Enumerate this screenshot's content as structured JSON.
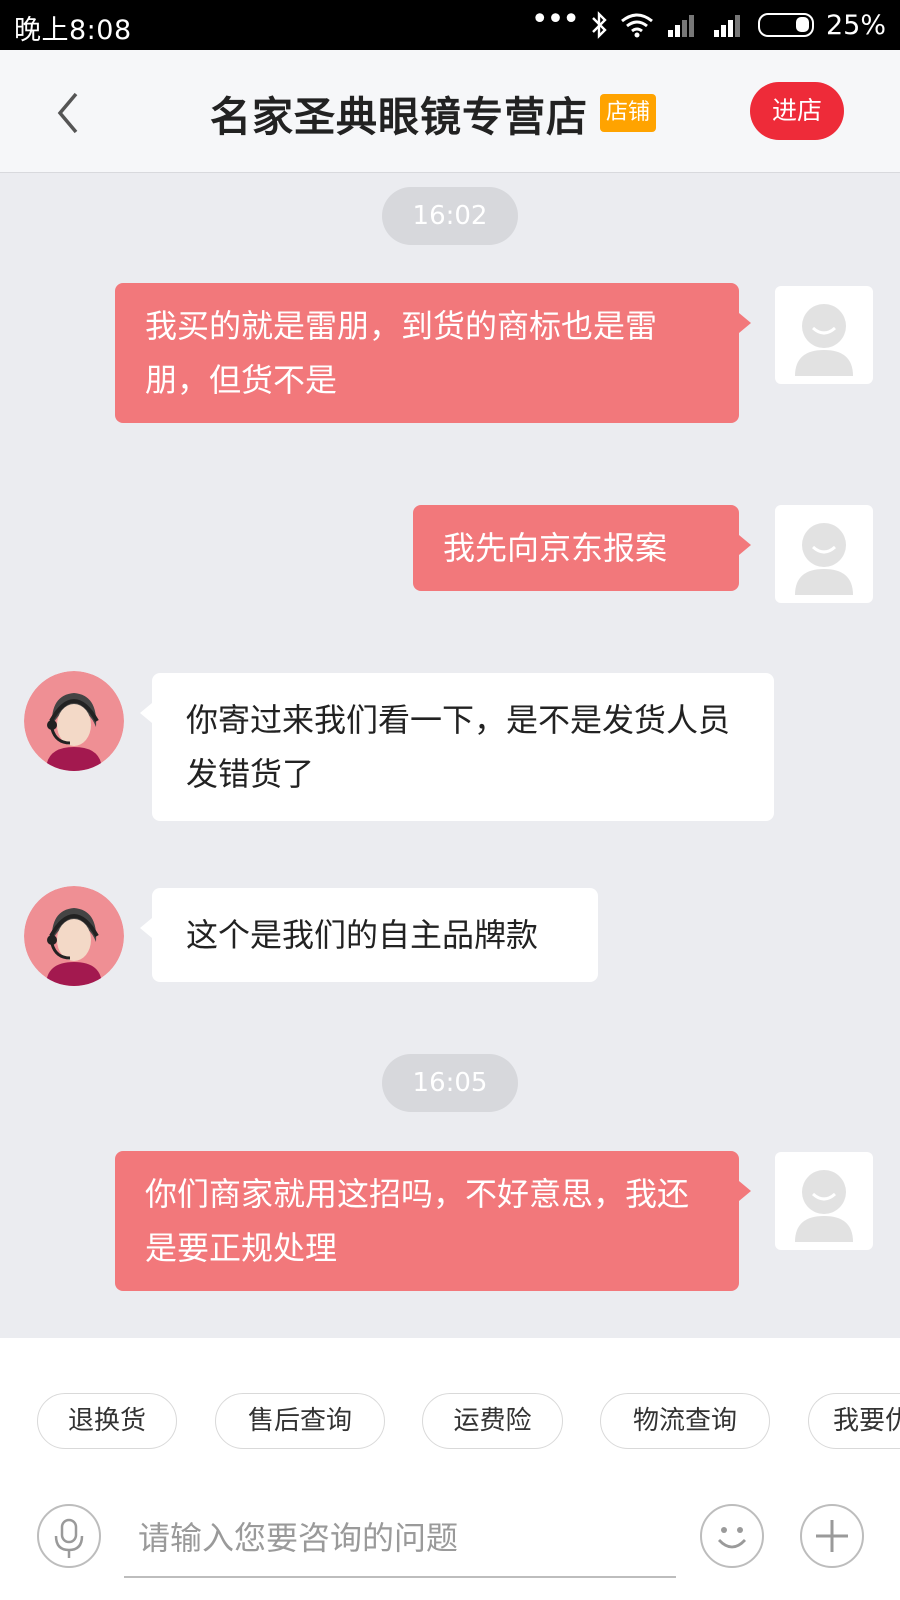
{
  "status_bar": {
    "time": "晚上8:08",
    "dots": "•••",
    "battery": "25%"
  },
  "header": {
    "title": "名家圣典眼镜专营店",
    "shop_tag": "店铺",
    "enter_label": "进店"
  },
  "chat": {
    "timestamps": [
      "16:02",
      "16:05"
    ],
    "messages": [
      {
        "from": "user",
        "text": "我买的就是雷朋，到货的商标也是雷朋，但货不是"
      },
      {
        "from": "user",
        "text": "我先向京东报案"
      },
      {
        "from": "agent",
        "text": "你寄过来我们看一下，是不是发货人员发错货了"
      },
      {
        "from": "agent",
        "text": "这个是我们的自主品牌款"
      },
      {
        "from": "user",
        "text": "你们商家就用这招吗，不好意思，我还是要正规处理"
      }
    ]
  },
  "quick_replies": [
    "退换货",
    "售后查询",
    "运费险",
    "物流查询",
    "我要优"
  ],
  "input": {
    "placeholder": "请输入您要咨询的问题"
  },
  "colors": {
    "user_bubble": "#f2787b",
    "accent_red": "#ee2b39",
    "shop_tag": "#ffa300",
    "chat_bg": "#ebecf0"
  },
  "icons": {
    "back": "chevron-left-icon",
    "mic": "microphone-icon",
    "emoji": "smiley-icon",
    "add": "plus-icon"
  }
}
